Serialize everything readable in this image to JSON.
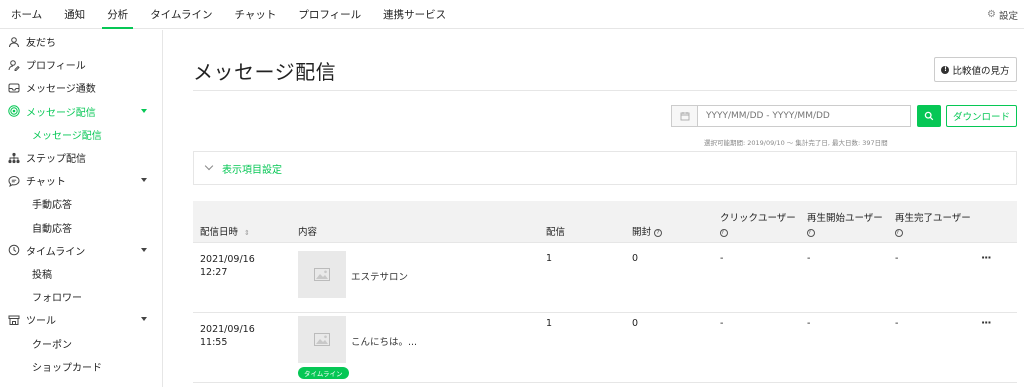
{
  "topnav": {
    "tabs": [
      "ホーム",
      "通知",
      "分析",
      "タイムライン",
      "チャット",
      "プロフィール",
      "連携サービス"
    ],
    "active_index": 2,
    "settings_label": "設定"
  },
  "sidebar": {
    "items": [
      {
        "label": "友だち",
        "icon": "person-icon"
      },
      {
        "label": "プロフィール",
        "icon": "person-edit-icon"
      },
      {
        "label": "メッセージ通数",
        "icon": "inbox-icon"
      },
      {
        "label": "メッセージ配信",
        "icon": "broadcast-icon",
        "active": true
      },
      {
        "label": "メッセージ配信",
        "sub": true,
        "active": true
      },
      {
        "label": "ステップ配信",
        "icon": "flow-icon"
      },
      {
        "label": "チャット",
        "icon": "chat-icon"
      },
      {
        "label": "手動応答",
        "sub": true
      },
      {
        "label": "自動応答",
        "sub": true
      },
      {
        "label": "タイムライン",
        "icon": "clock-icon"
      },
      {
        "label": "投稿",
        "sub": true
      },
      {
        "label": "フォロワー",
        "sub": true
      },
      {
        "label": "ツール",
        "icon": "store-icon"
      },
      {
        "label": "クーポン",
        "sub": true
      },
      {
        "label": "ショップカード",
        "sub": true
      }
    ]
  },
  "main": {
    "title": "メッセージ配信",
    "compare_button": "比較値の見方",
    "date_placeholder": "YYYY/MM/DD - YYYY/MM/DD",
    "download_button": "ダウンロード",
    "hint": "選択可能期間: 2019/09/10 〜 集計完了日, 最大日数: 397日間",
    "display_settings": "表示項目設定"
  },
  "table": {
    "headers": {
      "date": "配信日時",
      "content": "内容",
      "sent": "配信",
      "opened": "開封",
      "click_users": "クリックユーザー",
      "play_start_users": "再生開始ユーザー",
      "play_complete_users": "再生完了ユーザー"
    },
    "rows": [
      {
        "date": "2021/09/16",
        "time": "12:27",
        "content": "エステサロン",
        "sent": "1",
        "opened": "0",
        "click": "-",
        "play_start": "-",
        "play_complete": "-",
        "badge": ""
      },
      {
        "date": "2021/09/16",
        "time": "11:55",
        "content": "こんにちは。...",
        "sent": "1",
        "opened": "0",
        "click": "-",
        "play_start": "-",
        "play_complete": "-",
        "badge": "タイムライン"
      }
    ]
  },
  "colors": {
    "accent": "#06c755"
  }
}
